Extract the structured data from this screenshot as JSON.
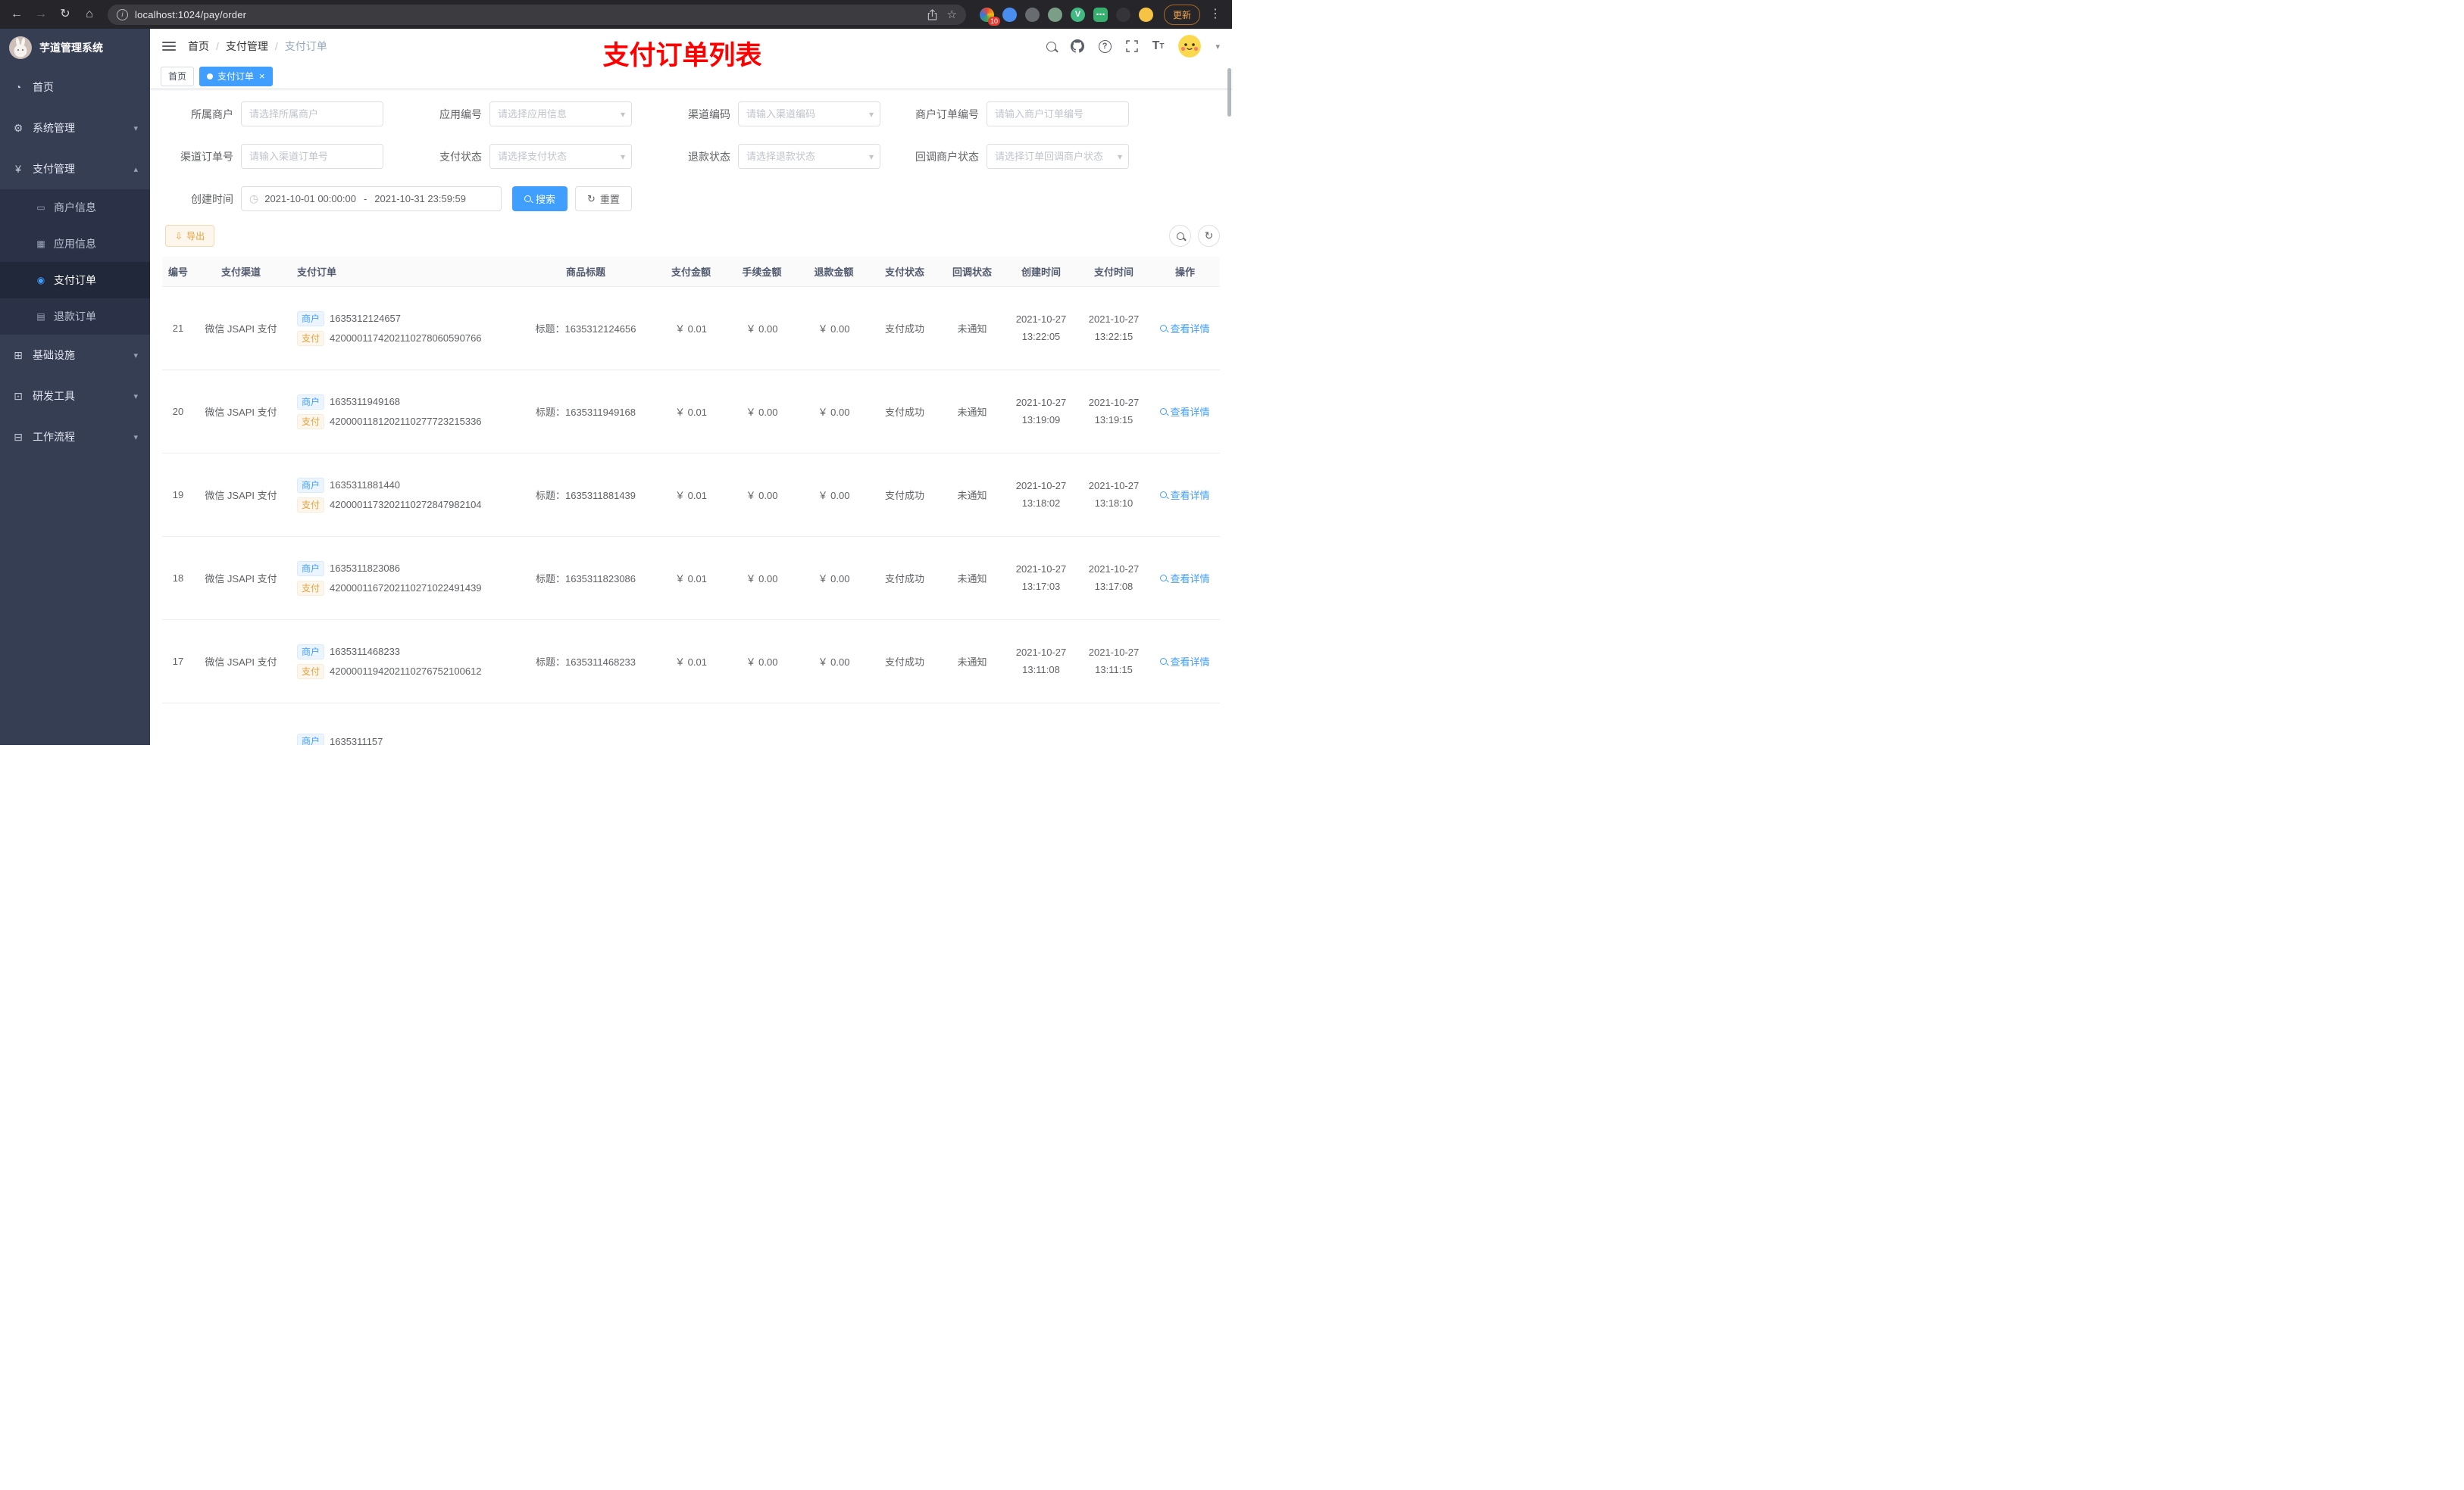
{
  "colors": {
    "accent": "#409eff",
    "warning": "#e6a23c",
    "annotation_red": "#ff0000",
    "sidebar_bg": "#363e54"
  },
  "browser": {
    "url": "localhost:1024/pay/order",
    "update_label": "更新",
    "extension_badge": "10"
  },
  "sidebar": {
    "app_title": "芋道管理系统",
    "menu": [
      {
        "label": "首页"
      },
      {
        "label": "系统管理"
      },
      {
        "label": "支付管理"
      },
      {
        "label": "商户信息"
      },
      {
        "label": "应用信息"
      },
      {
        "label": "支付订单"
      },
      {
        "label": "退款订单"
      },
      {
        "label": "基础设施"
      },
      {
        "label": "研发工具"
      },
      {
        "label": "工作流程"
      }
    ]
  },
  "header": {
    "breadcrumb": [
      "首页",
      "支付管理",
      "支付订单"
    ],
    "annotation": "支付订单列表"
  },
  "tabs": [
    {
      "label": "首页"
    },
    {
      "label": "支付订单"
    }
  ],
  "filters": {
    "merchant": {
      "label": "所属商户",
      "placeholder": "请选择所属商户"
    },
    "app_no": {
      "label": "应用编号",
      "placeholder": "请选择应用信息"
    },
    "channel_code": {
      "label": "渠道编码",
      "placeholder": "请输入渠道编码"
    },
    "merchant_order_no": {
      "label": "商户订单编号",
      "placeholder": "请输入商户订单编号"
    },
    "channel_order_no": {
      "label": "渠道订单号",
      "placeholder": "请输入渠道订单号"
    },
    "pay_status": {
      "label": "支付状态",
      "placeholder": "请选择支付状态"
    },
    "refund_status": {
      "label": "退款状态",
      "placeholder": "请选择退款状态"
    },
    "notify_status": {
      "label": "回调商户状态",
      "placeholder": "请选择订单回调商户状态"
    },
    "create_time": {
      "label": "创建时间",
      "start": "2021-10-01 00:00:00",
      "separator": "-",
      "end": "2021-10-31 23:59:59"
    },
    "search_label": "搜索",
    "reset_label": "重置"
  },
  "toolbar": {
    "export_label": "导出"
  },
  "table": {
    "columns": [
      "编号",
      "支付渠道",
      "支付订单",
      "商品标题",
      "支付金额",
      "手续金额",
      "退款金额",
      "支付状态",
      "回调状态",
      "创建时间",
      "支付时间",
      "操作"
    ],
    "badges": {
      "merchant": "商户",
      "pay": "支付"
    },
    "rows": [
      {
        "id": "21",
        "channel": "微信 JSAPI 支付",
        "merchant_no": "1635312124657",
        "channel_no": "4200001174202110278060590766",
        "title": "标题：1635312124656",
        "amount": "￥ 0.01",
        "fee": "￥ 0.00",
        "refund": "￥ 0.00",
        "status": "支付成功",
        "notify": "未通知",
        "create_time": "2021-10-27 13:22:05",
        "pay_time": "2021-10-27 13:22:15",
        "action": "查看详情"
      },
      {
        "id": "20",
        "channel": "微信 JSAPI 支付",
        "merchant_no": "1635311949168",
        "channel_no": "4200001181202110277723215336",
        "title": "标题：1635311949168",
        "amount": "￥ 0.01",
        "fee": "￥ 0.00",
        "refund": "￥ 0.00",
        "status": "支付成功",
        "notify": "未通知",
        "create_time": "2021-10-27 13:19:09",
        "pay_time": "2021-10-27 13:19:15",
        "action": "查看详情"
      },
      {
        "id": "19",
        "channel": "微信 JSAPI 支付",
        "merchant_no": "1635311881440",
        "channel_no": "4200001173202110272847982104",
        "title": "标题：1635311881439",
        "amount": "￥ 0.01",
        "fee": "￥ 0.00",
        "refund": "￥ 0.00",
        "status": "支付成功",
        "notify": "未通知",
        "create_time": "2021-10-27 13:18:02",
        "pay_time": "2021-10-27 13:18:10",
        "action": "查看详情"
      },
      {
        "id": "18",
        "channel": "微信 JSAPI 支付",
        "merchant_no": "1635311823086",
        "channel_no": "4200001167202110271022491439",
        "title": "标题：1635311823086",
        "amount": "￥ 0.01",
        "fee": "￥ 0.00",
        "refund": "￥ 0.00",
        "status": "支付成功",
        "notify": "未通知",
        "create_time": "2021-10-27 13:17:03",
        "pay_time": "2021-10-27 13:17:08",
        "action": "查看详情"
      },
      {
        "id": "17",
        "channel": "微信 JSAPI 支付",
        "merchant_no": "1635311468233",
        "channel_no": "4200001194202110276752100612",
        "title": "标题：1635311468233",
        "amount": "￥ 0.01",
        "fee": "￥ 0.00",
        "refund": "￥ 0.00",
        "status": "支付成功",
        "notify": "未通知",
        "create_time": "2021-10-27 13:11:08",
        "pay_time": "2021-10-27 13:11:15",
        "action": "查看详情"
      }
    ],
    "partial_row": {
      "merchant_no": "1635311157"
    }
  },
  "icons": {
    "back": "←",
    "forward": "→",
    "reload": "↻",
    "home": "⌂",
    "info": "i",
    "star": "☆",
    "menu_dots": "⋮",
    "vue": "V",
    "ellipsis": "⋯",
    "clock": "◷",
    "caret_down": "▾",
    "chevron_down": "▾",
    "chevron_up": "▴",
    "close": "×",
    "question": "?",
    "font_large": "T",
    "font_small": "T",
    "download": "⇩",
    "refresh": "↻",
    "reset": "↻",
    "dashboard": "◔",
    "gear": "⚙",
    "yen": "¥",
    "merchant": "▭",
    "app_grid": "▦",
    "order_dot": "◉",
    "refund_doc": "▤",
    "infra": "⊞",
    "devtool": "⊡",
    "workflow": "⊟"
  }
}
